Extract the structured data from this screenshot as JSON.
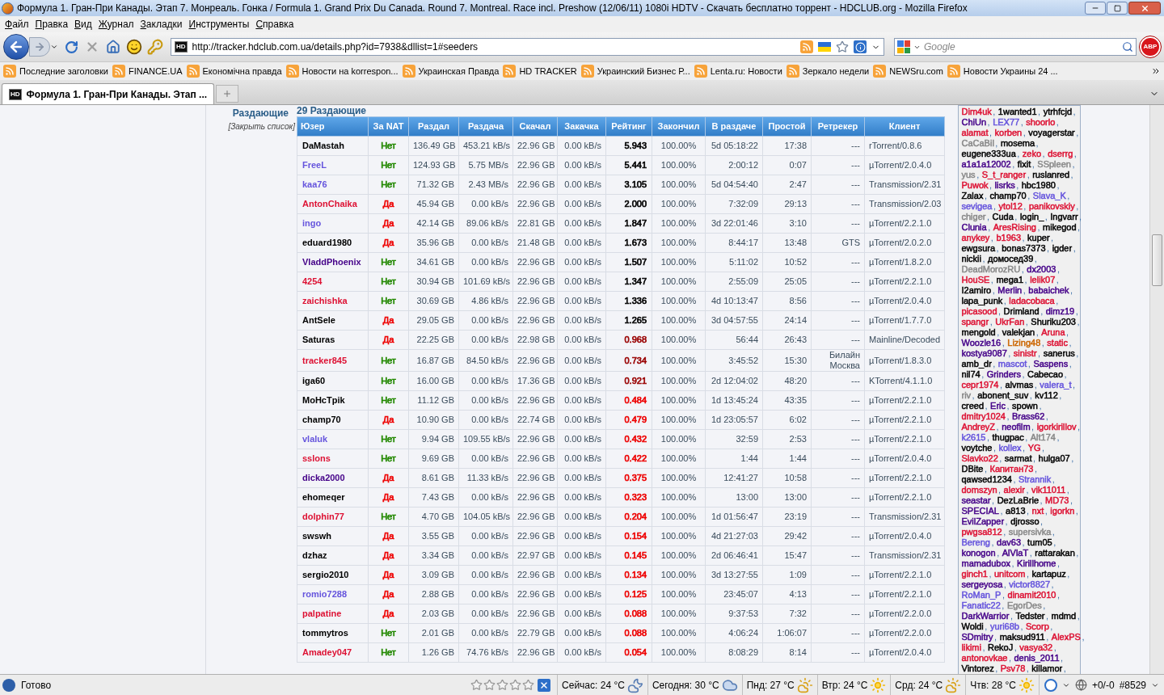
{
  "window": {
    "title": "Формула 1. Гран-При Канады. Этап 7. Монреаль. Гонка / Formula 1. Grand Prix Du Canada. Round 7. Montreal. Race incl. Preshow (12/06/11) 1080i HDTV - Скачать бесплатно торрент - HDCLUB.org - Mozilla Firefox"
  },
  "menu": [
    "Файл",
    "Правка",
    "Вид",
    "Журнал",
    "Закладки",
    "Инструменты",
    "Справка"
  ],
  "address": {
    "favicon_text": "HD",
    "value": "http://tracker.hdclub.com.ua/details.php?id=7938&dllist=1#seeders"
  },
  "search": {
    "placeholder": "Google"
  },
  "adblock": {
    "label": "ABP"
  },
  "bookmarks": [
    "Последние заголовки",
    "FINANCE.UA",
    "Економічна правда",
    "Новости на korrespon...",
    "Украинская Правда",
    "HD TRACKER",
    "Украинский Бизнес Р...",
    "Lenta.ru: Новости",
    "Зеркало недели",
    "NEWSru.com",
    "Новости Украины 24 ..."
  ],
  "tabs": [
    {
      "favicon_text": "HD",
      "label": "Формула 1. Гран-При Канады. Этап ...",
      "selected": true
    }
  ],
  "section": {
    "label": "Раздающие",
    "close_link": "[Закрыть список]",
    "count": "29 Раздающие"
  },
  "table": {
    "columns": [
      "Юзер",
      "За NAT",
      "Раздал",
      "Раздача",
      "Скачал",
      "Закачка",
      "Рейтинг",
      "Закончил",
      "В раздаче",
      "Простой",
      "Ретрекер",
      "Клиент"
    ],
    "rows": [
      {
        "cells": [
          {
            "text": "DaMastah",
            "color": "#000000"
          },
          {
            "text": "Нет",
            "color": "#228800"
          },
          "136.49 GB",
          "453.21 kB/s",
          "22.96 GB",
          "0.00 kB/s",
          {
            "text": "5.943",
            "color": "#000000"
          },
          "100.00%",
          "5d 05:18:22",
          "17:38",
          "---",
          "rTorrent/0.8.6"
        ]
      },
      {
        "cells": [
          {
            "text": "FreeL",
            "color": "#6655dd"
          },
          {
            "text": "Нет",
            "color": "#228800"
          },
          "124.93 GB",
          "5.75 MB/s",
          "22.96 GB",
          "0.00 kB/s",
          {
            "text": "5.441",
            "color": "#000000"
          },
          "100.00%",
          "2:00:12",
          "0:07",
          "---",
          "µTorrent/2.0.4.0"
        ]
      },
      {
        "cells": [
          {
            "text": "kaa76",
            "color": "#6655dd"
          },
          {
            "text": "Нет",
            "color": "#228800"
          },
          "71.32 GB",
          "2.43 MB/s",
          "22.96 GB",
          "0.00 kB/s",
          {
            "text": "3.105",
            "color": "#000000"
          },
          "100.00%",
          "5d 04:54:40",
          "2:47",
          "---",
          "Transmission/2.31"
        ]
      },
      {
        "cells": [
          {
            "text": "AntonChaika",
            "color": "#dd1133"
          },
          {
            "text": "Да",
            "color": "#ee0000"
          },
          "45.94 GB",
          "0.00 kB/s",
          "22.96 GB",
          "0.00 kB/s",
          {
            "text": "2.000",
            "color": "#000000"
          },
          "100.00%",
          "7:32:09",
          "29:13",
          "---",
          "Transmission/2.03"
        ]
      },
      {
        "cells": [
          {
            "text": "ingo",
            "color": "#6655dd"
          },
          {
            "text": "Да",
            "color": "#ee0000"
          },
          "42.14 GB",
          "89.06 kB/s",
          "22.81 GB",
          "0.00 kB/s",
          {
            "text": "1.847",
            "color": "#000000"
          },
          "100.00%",
          "3d 22:01:46",
          "3:10",
          "---",
          "µTorrent/2.2.1.0"
        ]
      },
      {
        "cells": [
          {
            "text": "eduard1980",
            "color": "#000000"
          },
          {
            "text": "Да",
            "color": "#ee0000"
          },
          "35.96 GB",
          "0.00 kB/s",
          "21.48 GB",
          "0.00 kB/s",
          {
            "text": "1.673",
            "color": "#000000"
          },
          "100.00%",
          "8:44:17",
          "13:48",
          "GTS",
          "µTorrent/2.0.2.0"
        ]
      },
      {
        "cells": [
          {
            "text": "VladdPhoenix",
            "color": "#440088"
          },
          {
            "text": "Нет",
            "color": "#228800"
          },
          "34.61 GB",
          "0.00 kB/s",
          "22.96 GB",
          "0.00 kB/s",
          {
            "text": "1.507",
            "color": "#000000"
          },
          "100.00%",
          "5:11:02",
          "10:52",
          "---",
          "µTorrent/1.8.2.0"
        ]
      },
      {
        "cells": [
          {
            "text": "4254",
            "color": "#dd1133"
          },
          {
            "text": "Нет",
            "color": "#228800"
          },
          "30.94 GB",
          "101.69 kB/s",
          "22.96 GB",
          "0.00 kB/s",
          {
            "text": "1.347",
            "color": "#000000"
          },
          "100.00%",
          "2:55:09",
          "25:05",
          "---",
          "µTorrent/2.2.1.0"
        ]
      },
      {
        "cells": [
          {
            "text": "zaichishka",
            "color": "#dd1133"
          },
          {
            "text": "Нет",
            "color": "#228800"
          },
          "30.69 GB",
          "4.86 kB/s",
          "22.96 GB",
          "0.00 kB/s",
          {
            "text": "1.336",
            "color": "#000000"
          },
          "100.00%",
          "4d 10:13:47",
          "8:56",
          "---",
          "µTorrent/2.0.4.0"
        ]
      },
      {
        "cells": [
          {
            "text": "AntSele",
            "color": "#000000"
          },
          {
            "text": "Да",
            "color": "#ee0000"
          },
          "29.05 GB",
          "0.00 kB/s",
          "22.96 GB",
          "0.00 kB/s",
          {
            "text": "1.265",
            "color": "#000000"
          },
          "100.00%",
          "3d 04:57:55",
          "24:14",
          "---",
          "µTorrent/1.7.7.0"
        ]
      },
      {
        "cells": [
          {
            "text": "Saturas",
            "color": "#000000"
          },
          {
            "text": "Да",
            "color": "#ee0000"
          },
          "22.25 GB",
          "0.00 kB/s",
          "22.98 GB",
          "0.00 kB/s",
          {
            "text": "0.968",
            "color": "#990000"
          },
          "100.00%",
          "56:44",
          "26:43",
          "---",
          "Mainline/Decoded"
        ]
      },
      {
        "cells": [
          {
            "text": "tracker845",
            "color": "#dd1133"
          },
          {
            "text": "Нет",
            "color": "#228800"
          },
          "16.87 GB",
          "84.50 kB/s",
          "22.96 GB",
          "0.00 kB/s",
          {
            "text": "0.734",
            "color": "#990000"
          },
          "100.00%",
          "3:45:52",
          "15:30",
          "Билайн Москва",
          "µTorrent/1.8.3.0"
        ]
      },
      {
        "cells": [
          {
            "text": "iga60",
            "color": "#000000"
          },
          {
            "text": "Нет",
            "color": "#228800"
          },
          "16.00 GB",
          "0.00 kB/s",
          "17.36 GB",
          "0.00 kB/s",
          {
            "text": "0.921",
            "color": "#990000"
          },
          "100.00%",
          "2d 12:04:02",
          "48:20",
          "---",
          "KTorrent/4.1.1.0"
        ]
      },
      {
        "cells": [
          {
            "text": "MoHcTpik",
            "color": "#000000"
          },
          {
            "text": "Нет",
            "color": "#228800"
          },
          "11.12 GB",
          "0.00 kB/s",
          "22.96 GB",
          "0.00 kB/s",
          {
            "text": "0.484",
            "color": "#ee0000"
          },
          "100.00%",
          "1d 13:45:24",
          "43:35",
          "---",
          "µTorrent/2.2.1.0"
        ]
      },
      {
        "cells": [
          {
            "text": "champ70",
            "color": "#000000"
          },
          {
            "text": "Да",
            "color": "#ee0000"
          },
          "10.90 GB",
          "0.00 kB/s",
          "22.74 GB",
          "0.00 kB/s",
          {
            "text": "0.479",
            "color": "#ee0000"
          },
          "100.00%",
          "1d 23:05:57",
          "6:02",
          "---",
          "µTorrent/2.2.1.0"
        ]
      },
      {
        "cells": [
          {
            "text": "vlaluk",
            "color": "#6655dd"
          },
          {
            "text": "Нет",
            "color": "#228800"
          },
          "9.94 GB",
          "109.55 kB/s",
          "22.96 GB",
          "0.00 kB/s",
          {
            "text": "0.432",
            "color": "#ee0000"
          },
          "100.00%",
          "32:59",
          "2:53",
          "---",
          "µTorrent/2.2.1.0"
        ]
      },
      {
        "cells": [
          {
            "text": "sslons",
            "color": "#dd1133"
          },
          {
            "text": "Нет",
            "color": "#228800"
          },
          "9.69 GB",
          "0.00 kB/s",
          "22.96 GB",
          "0.00 kB/s",
          {
            "text": "0.422",
            "color": "#ee0000"
          },
          "100.00%",
          "1:44",
          "1:44",
          "---",
          "µTorrent/2.0.4.0"
        ]
      },
      {
        "cells": [
          {
            "text": "dicka2000",
            "color": "#440088"
          },
          {
            "text": "Да",
            "color": "#ee0000"
          },
          "8.61 GB",
          "11.33 kB/s",
          "22.96 GB",
          "0.00 kB/s",
          {
            "text": "0.375",
            "color": "#ee0000"
          },
          "100.00%",
          "12:41:27",
          "10:58",
          "---",
          "µTorrent/2.2.1.0"
        ]
      },
      {
        "cells": [
          {
            "text": "ehomeqer",
            "color": "#000000"
          },
          {
            "text": "Да",
            "color": "#ee0000"
          },
          "7.43 GB",
          "0.00 kB/s",
          "22.96 GB",
          "0.00 kB/s",
          {
            "text": "0.323",
            "color": "#ee0000"
          },
          "100.00%",
          "13:00",
          "13:00",
          "---",
          "µTorrent/2.2.1.0"
        ]
      },
      {
        "cells": [
          {
            "text": "dolphin77",
            "color": "#dd1133"
          },
          {
            "text": "Нет",
            "color": "#228800"
          },
          "4.70 GB",
          "104.05 kB/s",
          "22.96 GB",
          "0.00 kB/s",
          {
            "text": "0.204",
            "color": "#ee0000"
          },
          "100.00%",
          "1d 01:56:47",
          "23:19",
          "---",
          "Transmission/2.31"
        ]
      },
      {
        "cells": [
          {
            "text": "swswh",
            "color": "#000000"
          },
          {
            "text": "Да",
            "color": "#ee0000"
          },
          "3.55 GB",
          "0.00 kB/s",
          "22.96 GB",
          "0.00 kB/s",
          {
            "text": "0.154",
            "color": "#ee0000"
          },
          "100.00%",
          "4d 21:27:03",
          "29:42",
          "---",
          "µTorrent/2.0.4.0"
        ]
      },
      {
        "cells": [
          {
            "text": "dzhaz",
            "color": "#000000"
          },
          {
            "text": "Да",
            "color": "#ee0000"
          },
          "3.34 GB",
          "0.00 kB/s",
          "22.97 GB",
          "0.00 kB/s",
          {
            "text": "0.145",
            "color": "#ee0000"
          },
          "100.00%",
          "2d 06:46:41",
          "15:47",
          "---",
          "Transmission/2.31"
        ]
      },
      {
        "cells": [
          {
            "text": "sergio2010",
            "color": "#000000"
          },
          {
            "text": "Да",
            "color": "#ee0000"
          },
          "3.09 GB",
          "0.00 kB/s",
          "22.96 GB",
          "0.00 kB/s",
          {
            "text": "0.134",
            "color": "#ee0000"
          },
          "100.00%",
          "3d 13:27:55",
          "1:09",
          "---",
          "µTorrent/2.2.1.0"
        ]
      },
      {
        "cells": [
          {
            "text": "romio7288",
            "color": "#6655dd"
          },
          {
            "text": "Да",
            "color": "#ee0000"
          },
          "2.88 GB",
          "0.00 kB/s",
          "22.96 GB",
          "0.00 kB/s",
          {
            "text": "0.125",
            "color": "#ee0000"
          },
          "100.00%",
          "23:45:07",
          "4:13",
          "---",
          "µTorrent/2.2.1.0"
        ]
      },
      {
        "cells": [
          {
            "text": "palpatine",
            "color": "#dd1133"
          },
          {
            "text": "Да",
            "color": "#ee0000"
          },
          "2.03 GB",
          "0.00 kB/s",
          "22.96 GB",
          "0.00 kB/s",
          {
            "text": "0.088",
            "color": "#ee0000"
          },
          "100.00%",
          "9:37:53",
          "7:32",
          "---",
          "µTorrent/2.2.0.0"
        ]
      },
      {
        "cells": [
          {
            "text": "tommytros",
            "color": "#000000"
          },
          {
            "text": "Нет",
            "color": "#228800"
          },
          "2.01 GB",
          "0.00 kB/s",
          "22.79 GB",
          "0.00 kB/s",
          {
            "text": "0.088",
            "color": "#ee0000"
          },
          "100.00%",
          "4:06:24",
          "1:06:07",
          "---",
          "µTorrent/2.2.0.0"
        ]
      },
      {
        "cells": [
          {
            "text": "Amadey047",
            "color": "#dd1133"
          },
          {
            "text": "Нет",
            "color": "#228800"
          },
          "1.26 GB",
          "74.76 kB/s",
          "22.96 GB",
          "0.00 kB/s",
          {
            "text": "0.054",
            "color": "#ee0000"
          },
          "100.00%",
          "8:08:29",
          "8:14",
          "---",
          "µTorrent/2.0.4.0"
        ]
      }
    ]
  },
  "user_list": {
    "separator": ",",
    "lines": [
      [
        {
          "name": "Dim4uk",
          "color": "#dd1133"
        },
        {
          "name": "1wanted1",
          "color": "#000000"
        },
        {
          "name": "ytrhfcjd",
          "color": "#000000"
        }
      ],
      [
        {
          "name": "ChiUn",
          "color": "#440088"
        },
        {
          "name": "LEX77",
          "color": "#6655dd"
        },
        {
          "name": "shoorlo",
          "color": "#dd1133"
        }
      ],
      [
        {
          "name": "alamat",
          "color": "#dd1133"
        },
        {
          "name": "korben",
          "color": "#dd1133"
        },
        {
          "name": "voyagerstar",
          "color": "#000000"
        }
      ],
      [
        {
          "name": "CaCaBil",
          "color": "#888888"
        },
        {
          "name": "mosema",
          "color": "#000000"
        }
      ],
      [
        {
          "name": "eugene333ua",
          "color": "#000000"
        },
        {
          "name": "zeko",
          "color": "#dd1133"
        },
        {
          "name": "dserrg",
          "color": "#dd1133"
        }
      ],
      [
        {
          "name": "a1a1a12002",
          "color": "#440088"
        },
        {
          "name": "fixit",
          "color": "#000000"
        },
        {
          "name": "SSpleen",
          "color": "#888888"
        }
      ],
      [
        {
          "name": "yus",
          "color": "#888888"
        },
        {
          "name": "S_t_ranger",
          "color": "#dd1133"
        },
        {
          "name": "ruslanred",
          "color": "#000000"
        }
      ],
      [
        {
          "name": "Puwok",
          "color": "#dd1133"
        },
        {
          "name": "lisrks",
          "color": "#440088"
        },
        {
          "name": "hbc1980",
          "color": "#000000"
        }
      ],
      [
        {
          "name": "Zalax",
          "color": "#000000"
        },
        {
          "name": "champ70",
          "color": "#000000"
        },
        {
          "name": "Slava_K",
          "color": "#6655dd"
        }
      ],
      [
        {
          "name": "sevigea",
          "color": "#6655dd"
        },
        {
          "name": "ytol12",
          "color": "#dd1133"
        },
        {
          "name": "panikovskiy",
          "color": "#dd1133"
        }
      ],
      [
        {
          "name": "chiger",
          "color": "#888888"
        },
        {
          "name": "Cuda",
          "color": "#000000"
        },
        {
          "name": "login_",
          "color": "#000000"
        },
        {
          "name": "Ingvarr",
          "color": "#000000"
        }
      ],
      [
        {
          "name": "Clunia",
          "color": "#440088"
        },
        {
          "name": "AresRising",
          "color": "#dd1133"
        },
        {
          "name": "mikegod",
          "color": "#000000"
        }
      ],
      [
        {
          "name": "anykey",
          "color": "#dd1133"
        },
        {
          "name": "b1963",
          "color": "#dd1133"
        },
        {
          "name": "kuper",
          "color": "#000000"
        }
      ],
      [
        {
          "name": "ewgsura",
          "color": "#000000"
        },
        {
          "name": "bonas7373",
          "color": "#000000"
        },
        {
          "name": "igder",
          "color": "#000000"
        }
      ],
      [
        {
          "name": "nickii",
          "color": "#000000"
        },
        {
          "name": "домосед39",
          "color": "#000000"
        }
      ],
      [
        {
          "name": "DeadMorozRU",
          "color": "#888888"
        },
        {
          "name": "dx2003",
          "color": "#440088"
        }
      ],
      [
        {
          "name": "HouSE",
          "color": "#dd1133"
        },
        {
          "name": "mega1",
          "color": "#000000"
        },
        {
          "name": "lelik07",
          "color": "#dd1133"
        }
      ],
      [
        {
          "name": "I2amiro",
          "color": "#000000"
        },
        {
          "name": "Merlin",
          "color": "#440088"
        },
        {
          "name": "babaichek",
          "color": "#440088"
        }
      ],
      [
        {
          "name": "lapa_punk",
          "color": "#000000"
        },
        {
          "name": "ladacobaca",
          "color": "#dd1133"
        }
      ],
      [
        {
          "name": "picasood",
          "color": "#dd1133"
        },
        {
          "name": "Drimland",
          "color": "#000000"
        },
        {
          "name": "dimz19",
          "color": "#440088"
        }
      ],
      [
        {
          "name": "spangr",
          "color": "#dd1133"
        },
        {
          "name": "UkrFan",
          "color": "#dd1133"
        },
        {
          "name": "Shuriku203",
          "color": "#000000"
        }
      ],
      [
        {
          "name": "mengold",
          "color": "#000000"
        },
        {
          "name": "valekjan",
          "color": "#000000"
        },
        {
          "name": "Aruna",
          "color": "#dd1133"
        }
      ],
      [
        {
          "name": "Woozle16",
          "color": "#440088"
        },
        {
          "name": "Lizing48",
          "color": "#cc6600"
        },
        {
          "name": "static",
          "color": "#dd1133"
        }
      ],
      [
        {
          "name": "kostya9087",
          "color": "#440088"
        },
        {
          "name": "sinistr",
          "color": "#dd1133"
        },
        {
          "name": "sanerus",
          "color": "#000000"
        }
      ],
      [
        {
          "name": "amb_dr",
          "color": "#000000"
        },
        {
          "name": "mascot",
          "color": "#6655dd"
        },
        {
          "name": "Saspens",
          "color": "#440088"
        }
      ],
      [
        {
          "name": "nil74",
          "color": "#000000"
        },
        {
          "name": "Grinders",
          "color": "#440088"
        },
        {
          "name": "Cabecao",
          "color": "#000000"
        }
      ],
      [
        {
          "name": "cepr1974",
          "color": "#dd1133"
        },
        {
          "name": "alvmas",
          "color": "#000000"
        },
        {
          "name": "valera_t",
          "color": "#6655dd"
        }
      ],
      [
        {
          "name": "riv",
          "color": "#888888"
        },
        {
          "name": "abonent_suv",
          "color": "#000000"
        },
        {
          "name": "kv112",
          "color": "#000000"
        }
      ],
      [
        {
          "name": "creed",
          "color": "#000000"
        },
        {
          "name": "Eric",
          "color": "#440088"
        },
        {
          "name": "spown",
          "color": "#000000"
        }
      ],
      [
        {
          "name": "dmitry1024",
          "color": "#dd1133"
        },
        {
          "name": "Brass62",
          "color": "#440088"
        }
      ],
      [
        {
          "name": "AndreyZ",
          "color": "#dd1133"
        },
        {
          "name": "neofilm",
          "color": "#440088"
        },
        {
          "name": "igorkirillov",
          "color": "#dd1133"
        }
      ],
      [
        {
          "name": "k2615",
          "color": "#6655dd"
        },
        {
          "name": "thugpac",
          "color": "#000000"
        },
        {
          "name": "Alt174",
          "color": "#888888"
        }
      ],
      [
        {
          "name": "voytche",
          "color": "#000000"
        },
        {
          "name": "kollex",
          "color": "#6655dd"
        },
        {
          "name": "YG",
          "color": "#dd1133"
        }
      ],
      [
        {
          "name": "Slavko22",
          "color": "#dd1133"
        },
        {
          "name": "sarmat",
          "color": "#000000"
        },
        {
          "name": "hulga07",
          "color": "#000000"
        }
      ],
      [
        {
          "name": "DBite",
          "color": "#000000"
        },
        {
          "name": "Капитан73",
          "color": "#dd1133"
        }
      ],
      [
        {
          "name": "qawsed1234",
          "color": "#000000"
        },
        {
          "name": "Strannik",
          "color": "#6655dd"
        }
      ],
      [
        {
          "name": "domszyn",
          "color": "#dd1133"
        },
        {
          "name": "alexir",
          "color": "#dd1133"
        },
        {
          "name": "vik11011",
          "color": "#dd1133"
        }
      ],
      [
        {
          "name": "seastar",
          "color": "#440088"
        },
        {
          "name": "DezLaBrie",
          "color": "#000000"
        },
        {
          "name": "MD73",
          "color": "#dd1133"
        }
      ],
      [
        {
          "name": "SPECIAL",
          "color": "#440088"
        },
        {
          "name": "a813",
          "color": "#000000"
        },
        {
          "name": "nxt",
          "color": "#dd1133"
        },
        {
          "name": "igorkn",
          "color": "#dd1133"
        }
      ],
      [
        {
          "name": "EvilZapper",
          "color": "#440088"
        },
        {
          "name": "djrosso",
          "color": "#000000"
        }
      ],
      [
        {
          "name": "pwgsa812",
          "color": "#dd1133"
        },
        {
          "name": "supersivka",
          "color": "#888888"
        }
      ],
      [
        {
          "name": "Bereng",
          "color": "#6655dd"
        },
        {
          "name": "dav63",
          "color": "#440088"
        },
        {
          "name": "tum05",
          "color": "#000000"
        }
      ],
      [
        {
          "name": "konogon",
          "color": "#440088"
        },
        {
          "name": "AlVlaT",
          "color": "#440088"
        },
        {
          "name": "rattarakan",
          "color": "#000000"
        }
      ],
      [
        {
          "name": "mamadubox",
          "color": "#440088"
        },
        {
          "name": "Kirillhome",
          "color": "#440088"
        }
      ],
      [
        {
          "name": "ginch1",
          "color": "#dd1133"
        },
        {
          "name": "unitcom",
          "color": "#dd1133"
        },
        {
          "name": "kartapuz",
          "color": "#000000"
        }
      ],
      [
        {
          "name": "sergeyosa",
          "color": "#440088"
        },
        {
          "name": "victor8827",
          "color": "#6655dd"
        }
      ],
      [
        {
          "name": "RoMan_P",
          "color": "#6655dd"
        },
        {
          "name": "dinamit2010",
          "color": "#dd1133"
        }
      ],
      [
        {
          "name": "Fanatic22",
          "color": "#6655dd"
        },
        {
          "name": "EgorDes",
          "color": "#888888"
        }
      ],
      [
        {
          "name": "DarkWarrior",
          "color": "#440088"
        },
        {
          "name": "Tedster",
          "color": "#000000"
        },
        {
          "name": "mdmd",
          "color": "#000000"
        }
      ],
      [
        {
          "name": "Woldi",
          "color": "#000000"
        },
        {
          "name": "yuri68b",
          "color": "#6655dd"
        },
        {
          "name": "Scorp",
          "color": "#dd1133"
        }
      ],
      [
        {
          "name": "SDmitry",
          "color": "#440088"
        },
        {
          "name": "maksud911",
          "color": "#000000"
        },
        {
          "name": "AlexPS",
          "color": "#dd1133"
        }
      ],
      [
        {
          "name": "likimi",
          "color": "#dd1133"
        },
        {
          "name": "RekoJ",
          "color": "#000000"
        },
        {
          "name": "vasya32",
          "color": "#dd1133"
        }
      ],
      [
        {
          "name": "antonovkae",
          "color": "#dd1133"
        },
        {
          "name": "denis_2011",
          "color": "#440088"
        }
      ],
      [
        {
          "name": "Vintorez",
          "color": "#000000"
        },
        {
          "name": "Psv78",
          "color": "#dd1133"
        },
        {
          "name": "killamor",
          "color": "#000000"
        }
      ]
    ]
  },
  "status_bar": {
    "text": "Готово",
    "stars": 0,
    "weather": [
      {
        "label": "Сейчас: 24 °C",
        "kind": "night"
      },
      {
        "label": "Сегодня: 30 °C",
        "kind": "cloud"
      },
      {
        "label": "Пнд: 27 °C",
        "kind": "partly"
      },
      {
        "label": "Втр: 24 °C",
        "kind": "sun"
      },
      {
        "label": "Срд: 24 °C",
        "kind": "partly"
      },
      {
        "label": "Чтв: 28 °C",
        "kind": "sun"
      }
    ],
    "counter": "+0/-0",
    "number": "#8529"
  }
}
